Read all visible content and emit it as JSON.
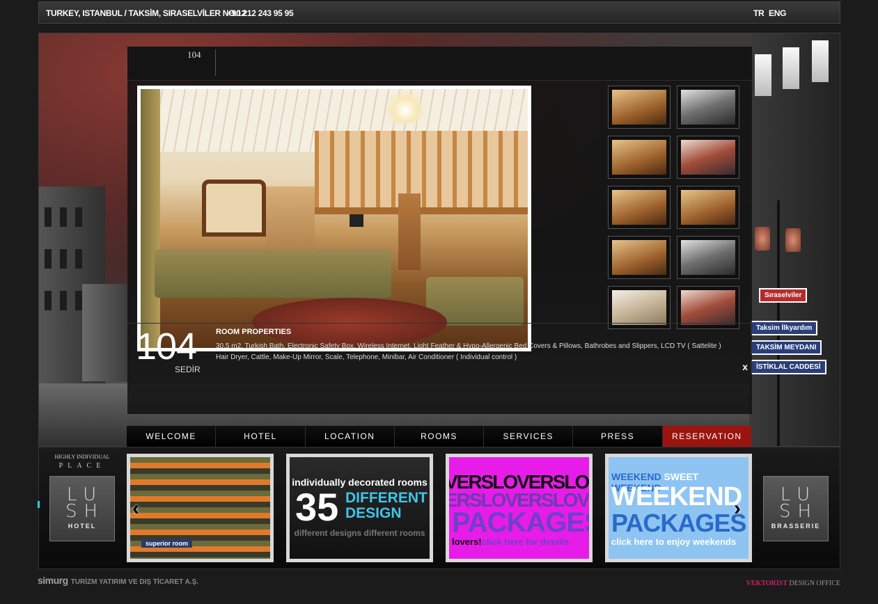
{
  "header": {
    "address": "TURKEY, ISTANBUL / TAKSİM, SIRASELVİLER NO.12",
    "phone": "+90 212 243 95 95",
    "lang_tr": "TR",
    "lang_en": "ENG"
  },
  "gallery": {
    "tab_label": "104",
    "thumbnails": [
      "room",
      "person",
      "room",
      "dress",
      "room",
      "room",
      "room",
      "person",
      "bath",
      "dress"
    ]
  },
  "room": {
    "number": "104",
    "name": "SEDİR",
    "properties_title": "ROOM PROPERTIES",
    "properties_text": "30.5 m2, Turkish Bath, Electronic Safety Box, Wireless Internet, Light Feather & Hypo-Allergenic Bed Covers & Pillows, Bathrobes and Slippers, LCD TV ( Sattelite ) Hair Dryer, Cattle, Make-Up Mirror, Scale, Telephone, Minibar, Air Conditioner ( Individual control )",
    "close": "x"
  },
  "signs": {
    "s1": "Sıraselviler",
    "s2": "Taksim İlkyardım",
    "s3": "TAKSİM MEYDANI",
    "s4": "İSTİKLAL CADDESİ"
  },
  "nav": [
    "WELCOME",
    "HOTEL",
    "LOCATION",
    "ROOMS",
    "SERVICES",
    "PRESS",
    "RESERVATION"
  ],
  "strip": {
    "tagline_1": "HIGHLY INDIVIDUAL",
    "tagline_2": "PLACE",
    "logo_left_big": "LU SH",
    "logo_left_small": "HOTEL",
    "logo_right_big": "LU SH",
    "logo_right_small": "BRASSERIE",
    "promo1_caption": "superior room",
    "promo2_line1": "individually decorated rooms",
    "promo2_num": "35",
    "promo2_word1": "DIFFERENT",
    "promo2_word2": "DESIGN",
    "promo2_line3": "different designs different rooms",
    "promo3_row1": "VERSLOVERSLO",
    "promo3_row2": "ERSLOVERSLOV",
    "promo3_row3": "PACKAGES",
    "promo3_row4a": "lovers!",
    "promo3_row4b": "click here for details",
    "promo4_row1a": "WEEKEND",
    "promo4_row1b": "SWEET",
    "promo4_row1c": "WEEKEND",
    "promo4_row2": "WEEKEND",
    "promo4_row3": "PACKAGES",
    "promo4_row4": "click here to enjoy weekends",
    "arrow_left": "‹",
    "arrow_right": "›"
  },
  "footer": {
    "brand": "simurg",
    "company": "TURİZM YATIRIM VE DIŞ TİCARET A.Ş.",
    "designer_v": "VEKTORIST",
    "designer_rest": "DESIGN OFFICE"
  },
  "colors": {
    "nav_active": "#9a1410",
    "accent_cyan": "#3fc5e8",
    "promo_magenta": "#e81ce8",
    "promo_blue": "#8ec4f2"
  }
}
